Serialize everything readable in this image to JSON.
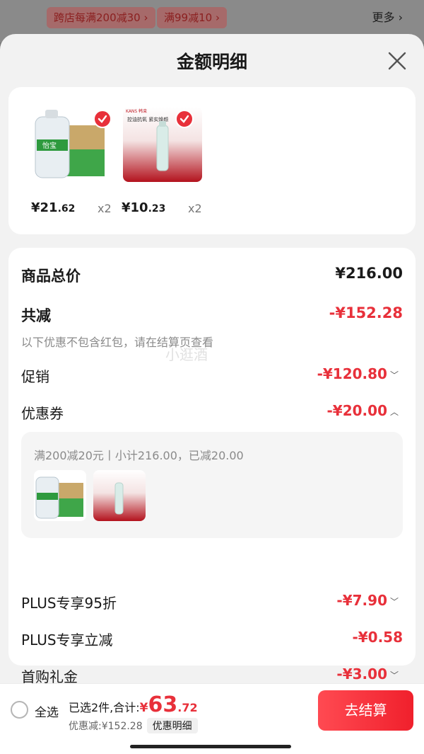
{
  "background": {
    "promos": [
      "跨店每满200减30 ›",
      "满99减10 ›"
    ],
    "more": "更多 ›"
  },
  "sheet": {
    "title": "金额明细"
  },
  "products": [
    {
      "price_int": "¥21",
      "price_dec": ".62",
      "qty": "x2",
      "image": "water-bottle-with-box"
    },
    {
      "price_int": "¥10",
      "price_dec": ".23",
      "qty": "x2",
      "image": "serum-bottle-red"
    }
  ],
  "product_image_texts": {
    "water_brand": "怡宝",
    "serum_brand": "KANS 韩束",
    "serum_caption": "控油抗氧 紧实焕颜"
  },
  "summary": {
    "total_label": "商品总价",
    "total_value": "¥216.00",
    "reduction_label": "共减",
    "reduction_value": "-¥152.28",
    "note": "以下优惠不包含红包，请在结算页查看",
    "watermark": "小逛酒"
  },
  "discounts": [
    {
      "label": "促销",
      "value": "-¥120.80",
      "chevron": "down"
    },
    {
      "label": "优惠券",
      "value": "-¥20.00",
      "chevron": "up"
    },
    {
      "label": "PLUS专享95折",
      "value": "-¥7.90",
      "chevron": "down"
    },
    {
      "label": "PLUS专享立减",
      "value": "-¥0.58",
      "chevron": ""
    },
    {
      "label": "首购礼金",
      "value": "-¥3.00",
      "chevron": "down"
    }
  ],
  "coupon_detail": {
    "description": "满200减20元丨小计216.00，已减20.00"
  },
  "bottom_bar": {
    "select_all": "全选",
    "selected_label": "已选2件,合计:",
    "total_currency": "¥",
    "total_int": "63",
    "total_dec": ".72",
    "discount_line": "优惠减:¥152.28",
    "detail_button": "优惠明细",
    "checkout": "去结算"
  },
  "colors": {
    "accent": "#e8303a",
    "sheet_bg": "#f2f2f2",
    "card_bg": "#ffffff"
  }
}
